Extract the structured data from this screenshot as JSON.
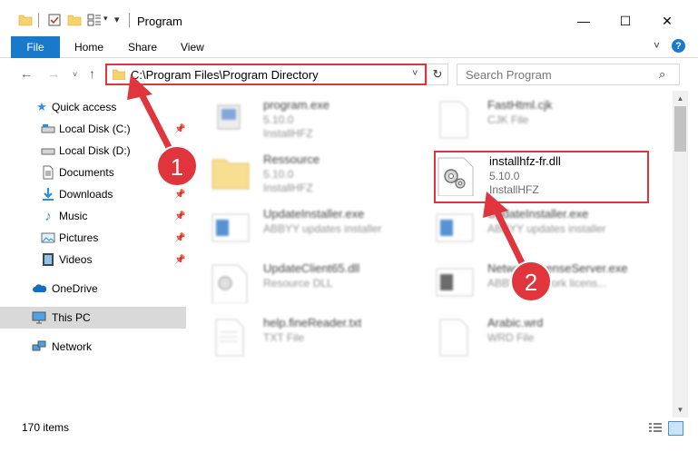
{
  "titlebar": {
    "title": "Program",
    "qa_dropdown": "▾",
    "qa_customize": "▾",
    "minimize": "—",
    "maximize": "☐",
    "close": "✕"
  },
  "ribbon": {
    "tabs": [
      "File",
      "Home",
      "Share",
      "View"
    ],
    "expand": "˅",
    "help": "?"
  },
  "address": {
    "back": "←",
    "forward": "→",
    "recent": "˅",
    "up": "↑",
    "path": "C:\\Program Files\\Program Directory",
    "dropdown": "˅",
    "refresh": "↻",
    "search_placeholder": "Search Program",
    "search_icon": "⌕"
  },
  "sidebar": {
    "items": [
      {
        "label": "Quick access",
        "icon": "star-icon"
      },
      {
        "label": "Local Disk (C:)",
        "icon": "drive-icon",
        "pinned": true
      },
      {
        "label": "Local Disk (D:)",
        "icon": "drive-icon",
        "pinned": false
      },
      {
        "label": "Documents",
        "icon": "documents-icon",
        "pinned": true
      },
      {
        "label": "Downloads",
        "icon": "downloads-icon",
        "pinned": true
      },
      {
        "label": "Music",
        "icon": "music-icon",
        "pinned": true
      },
      {
        "label": "Pictures",
        "icon": "pictures-icon",
        "pinned": true
      },
      {
        "label": "Videos",
        "icon": "videos-icon",
        "pinned": true
      },
      {
        "label": "OneDrive",
        "icon": "cloud-icon"
      },
      {
        "label": "This PC",
        "icon": "computer-icon",
        "selected": true
      },
      {
        "label": "Network",
        "icon": "network-icon"
      }
    ],
    "pin_glyph": "📌"
  },
  "files": [
    {
      "name": "program.exe",
      "meta1": "5.10.0",
      "meta2": "InstallHFZ",
      "icon": "exe-icon"
    },
    {
      "name": "FastHtml.cjk",
      "meta1": "CJK File",
      "meta2": "",
      "icon": "blank-file-icon"
    },
    {
      "name": "Ressource",
      "meta1": "5.10.0",
      "meta2": "InstallHFZ",
      "icon": "folder-icon"
    },
    {
      "name": "installhfz-fr.dll",
      "meta1": "5.10.0",
      "meta2": "InstallHFZ",
      "icon": "dll-gear-icon"
    },
    {
      "name": "UpdateInstaller.exe",
      "meta1": "ABBYY updates installer",
      "meta2": "",
      "icon": "installer-icon"
    },
    {
      "name": "UpdateInstaller.exe",
      "meta1": "ABBYY updates installer",
      "meta2": "",
      "icon": "installer-icon"
    },
    {
      "name": "UpdateClient65.dll",
      "meta1": "Resource DLL",
      "meta2": "",
      "icon": "dll-gear-icon"
    },
    {
      "name": "NetworkLicenseServer.exe",
      "meta1": "ABBYY Network licens...",
      "meta2": "",
      "icon": "installer-icon"
    },
    {
      "name": "help.fineReader.txt",
      "meta1": "TXT File",
      "meta2": "",
      "icon": "text-file-icon"
    },
    {
      "name": "Arabic.wrd",
      "meta1": "WRD File",
      "meta2": "",
      "icon": "blank-file-icon"
    }
  ],
  "annotations": {
    "badge1": "1",
    "badge2": "2",
    "color": "#e0353c"
  },
  "scroll": {
    "up": "▲",
    "down": "▼"
  },
  "status": {
    "count": "170 items"
  },
  "colors": {
    "accent": "#1979ca",
    "annotation_red": "#e0353c",
    "selected_bg": "#d9d9d9"
  }
}
